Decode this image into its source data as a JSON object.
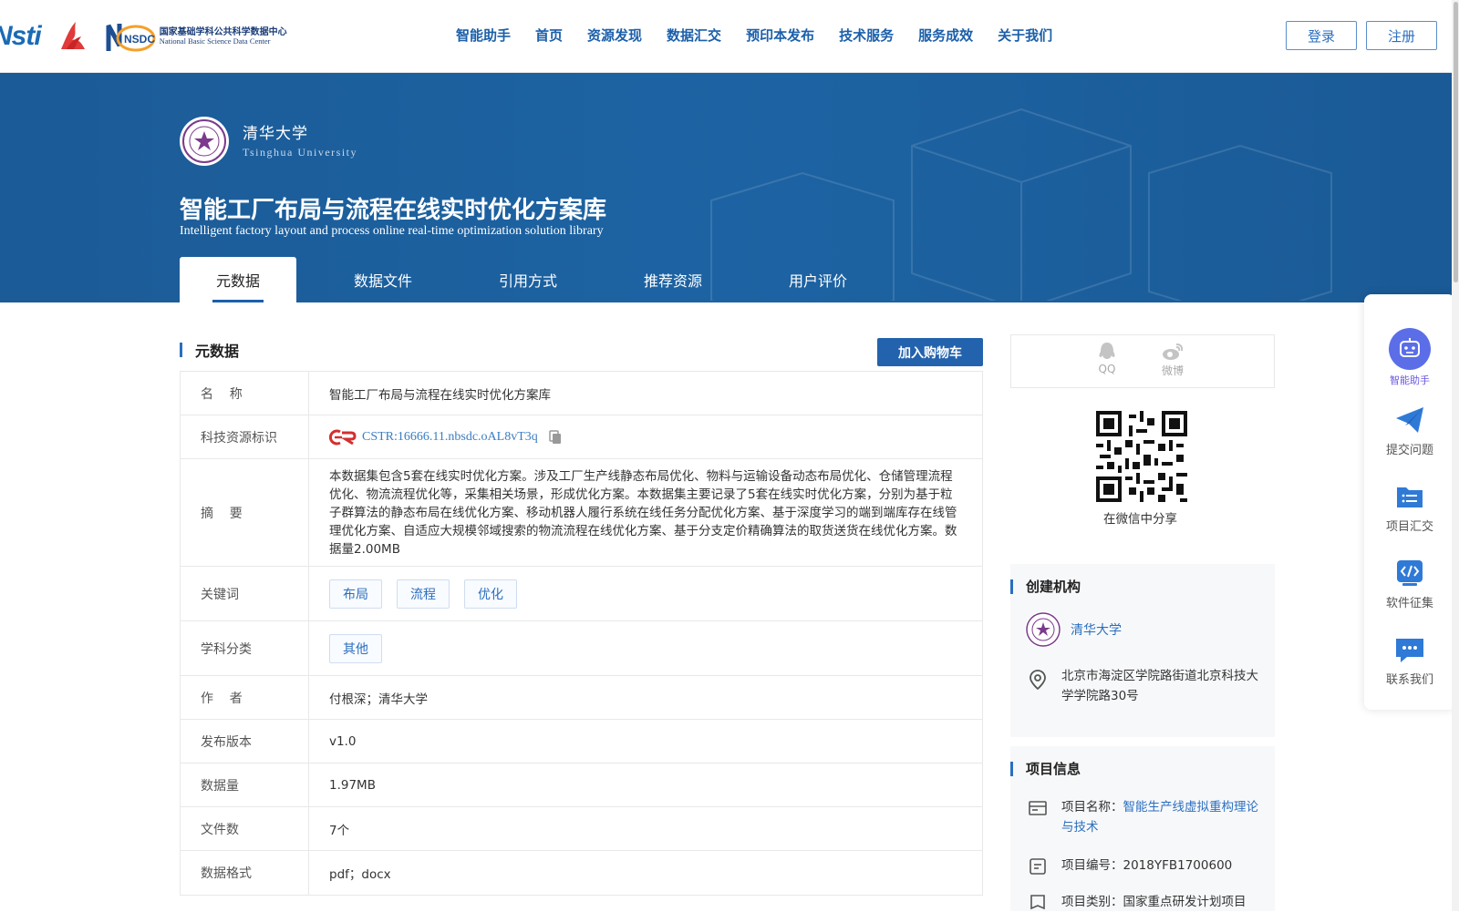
{
  "header": {
    "logo_text": "Nsti",
    "nsdc_logo": "NSDC",
    "nsdc_cn": "国家基础学科公共科学数据中心",
    "nsdc_en": "National Basic Science Data Center",
    "nav": [
      "智能助手",
      "首页",
      "资源发现",
      "数据汇交",
      "预印本发布",
      "技术服务",
      "服务成效",
      "关于我们"
    ],
    "login_label": "登录",
    "register_label": "注册"
  },
  "banner": {
    "institution_cn": "清华大学",
    "institution_en": "Tsinghua University",
    "title_cn": "智能工厂布局与流程在线实时优化方案库",
    "title_en": "Intelligent factory layout and process online real-time optimization solution library",
    "tabs": [
      "元数据",
      "数据文件",
      "引用方式",
      "推荐资源",
      "用户评价"
    ]
  },
  "metadata": {
    "section_title": "元数据",
    "cart_label": "加入购物车",
    "name_label": "名    称",
    "name_value": "智能工厂布局与流程在线实时优化方案库",
    "cstr_label": "科技资源标识",
    "cstr_value": "CSTR:16666.11.nbsdc.oAL8vT3q",
    "abstract_label": "摘    要",
    "abstract_value": "本数据集包含5套在线实时优化方案。涉及工厂生产线静态布局优化、物料与运输设备动态布局优化、仓储管理流程优化、物流流程优化等，采集相关场景，形成优化方案。本数据集主要记录了5套在线实时优化方案，分别为基于粒子群算法的静态布局在线优化方案、移动机器人履行系统在线任务分配优化方案、基于深度学习的端到端库存在线管理优化方案、自适应大规模邻域搜索的物流流程在线优化方案、基于分支定价精确算法的取货送货在线优化方案。数据量2.00MB",
    "keywords_label": "关键词",
    "keywords": [
      "布局",
      "流程",
      "优化"
    ],
    "subject_label": "学科分类",
    "subject": "其他",
    "author_label": "作    者",
    "author_value": "付根深；清华大学",
    "version_label": "发布版本",
    "version_value": "v1.0",
    "size_label": "数据量",
    "size_value": "1.97MB",
    "files_label": "文件数",
    "files_value": "7个",
    "format_label": "数据格式",
    "format_value": "pdf；docx"
  },
  "share": {
    "qq_label": "QQ",
    "weibo_label": "微博",
    "wechat_label": "在微信中分享"
  },
  "creator": {
    "title": "创建机构",
    "org_name": "清华大学",
    "address": "北京市海淀区学院路街道北京科技大学学院路30号"
  },
  "project": {
    "title": "项目信息",
    "name_label": "项目名称：",
    "name_value": "智能生产线虚拟重构理论与技术",
    "code_label": "项目编号：",
    "code_value": "2018YFB1700600",
    "type_label": "项目类别：",
    "type_value": "国家重点研发计划项目"
  },
  "float_bar": {
    "items": [
      "智能助手",
      "提交问题",
      "项目汇交",
      "软件征集",
      "联系我们"
    ]
  },
  "colors": {
    "primary": "#1b5faa",
    "banner": "#1d63a3",
    "accent_purple": "#6a5ae0"
  }
}
